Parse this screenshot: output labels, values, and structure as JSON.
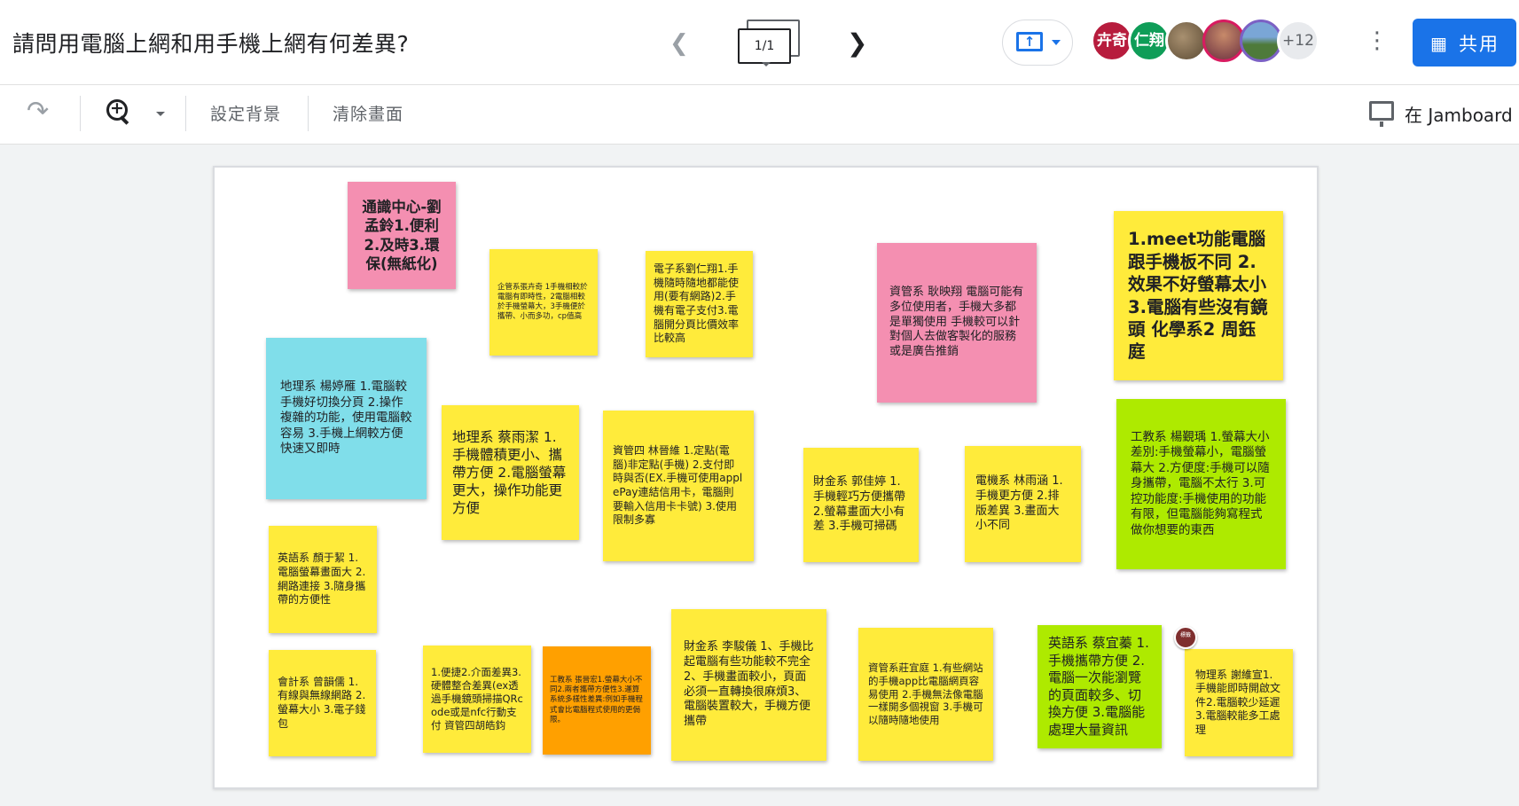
{
  "header": {
    "title": "請問用電腦上網和用手機上網有何差異?",
    "frame_counter": "1/1",
    "avatars": [
      {
        "label": "卉奇",
        "color": "#b71c3d"
      },
      {
        "label": "仁翔",
        "color": "#0f9d58"
      },
      {
        "label": "",
        "color": "#6d5b3f"
      },
      {
        "label": "",
        "color": "#8e4b52"
      },
      {
        "label": "",
        "color": "#4a6b8a"
      },
      {
        "label": "+12",
        "color": "#e8eaed"
      }
    ],
    "share_label": "共用"
  },
  "toolbar": {
    "set_background": "設定背景",
    "clear_frame": "清除畫面",
    "open_in_jamboard": "在 Jamboard"
  },
  "pin_label": "標籤",
  "notes": [
    {
      "text": "通識中心-劉孟鈴1.便利2.及時3.環保(無紙化)",
      "color": "#f48fb1"
    },
    {
      "text": "企管系張卉奇 1手機相較於電腦有即時性，2電腦相較於手機螢幕大，3手機便於攜帶、小而多功，cp值高",
      "color": "#ffeb3b"
    },
    {
      "text": "電子系劉仁翔1.手機隨時隨地都能使用(要有網路)2.手機有電子支付3.電腦開分頁比價效率比較高",
      "color": "#ffeb3b"
    },
    {
      "text": "資管系 耿映翔 電腦可能有多位使用者，手機大多都是單獨使用 手機較可以針對個人去做客製化的服務或是廣告推銷",
      "color": "#f48fb1"
    },
    {
      "text": "1.meet功能電腦跟手機板不同 2.效果不好螢幕太小 3.電腦有些沒有鏡頭 化學系2 周鈺庭",
      "color": "#ffeb3b"
    },
    {
      "text": "地理系 楊婷雁 1.電腦較手機好切換分頁 2.操作複雜的功能，使用電腦較容易 3.手機上網較方便快速又即時",
      "color": "#80deea"
    },
    {
      "text": "地理系 蔡雨潔 1.手機體積更小、攜帶方便 2.電腦螢幕更大，操作功能更方便",
      "color": "#ffeb3b"
    },
    {
      "text": "資管四 林晉維 1.定點(電腦)非定點(手機) 2.支付即時與否(EX.手機可使用applePay連結信用卡，電腦則要輸入信用卡卡號) 3.使用限制多寡",
      "color": "#ffeb3b"
    },
    {
      "text": "財金系 郭佳婷 1.手機輕巧方便攜帶 2.螢幕畫面大小有差 3.手機可掃碼",
      "color": "#ffeb3b"
    },
    {
      "text": "電機系 林雨涵 1.手機更方便 2.排版差異 3.畫面大小不同",
      "color": "#ffeb3b"
    },
    {
      "text": "工教系 楊覲瑀 1.螢幕大小差別:手機螢幕小，電腦螢幕大 2.方便度:手機可以隨身攜帶，電腦不太行 3.可控功能度:手機使用的功能有限，但電腦能夠寫程式做你想要的東西",
      "color": "#aeea00"
    },
    {
      "text": "英語系 顏于絜 1.電腦螢幕畫面大 2.網路連接 3.隨身攜帶的方便性",
      "color": "#ffeb3b"
    },
    {
      "text": "會計系 曾韻儒 1.有線與無線網路 2.螢幕大小 3.電子錢包",
      "color": "#ffeb3b"
    },
    {
      "text": "1.便捷2.介面差異3.硬體整合差異(ex透過手機鏡頭掃描QRcode或是nfc行動支付 資管四胡皓鈞",
      "color": "#ffeb3b"
    },
    {
      "text": "工教系 張晉宏1.螢幕大小不同2.兩者攜帶方便性3.運算系統多樣性差異:例如手機程式會比電腦程式使用的更侷限。",
      "color": "#ffa000"
    },
    {
      "text": "財金系 李駿儀 1、手機比起電腦有些功能較不完全2、手機畫面較小，頁面必須一直轉換很麻煩3、電腦裝置較大，手機方便攜帶",
      "color": "#ffeb3b"
    },
    {
      "text": "資管系莊宜庭 1.有些網站的手機app比電腦網頁容易使用 2.手機無法像電腦一樣開多個視窗 3.手機可以隨時隨地使用",
      "color": "#ffeb3b"
    },
    {
      "text": "英語系 蔡宜蓁 1.手機攜帶方便 2.電腦一次能瀏覽的頁面較多、切換方便 3.電腦能處理大量資訊",
      "color": "#aeea00"
    },
    {
      "text": "物理系 謝維宣1.手機能即時開啟文件2.電腦較少延遲3.電腦較能多工處理",
      "color": "#ffeb3b"
    }
  ]
}
